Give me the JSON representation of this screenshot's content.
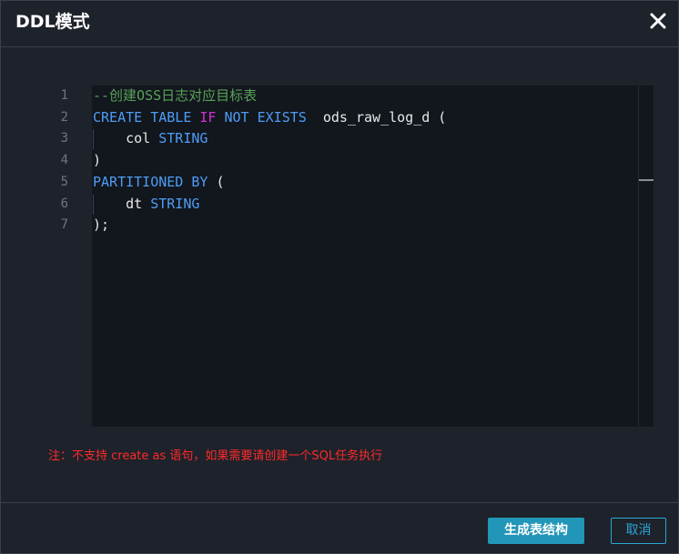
{
  "dialog": {
    "title": "DDL模式",
    "close_icon": "close-icon"
  },
  "editor": {
    "line_numbers": [
      "1",
      "2",
      "3",
      "4",
      "5",
      "6",
      "7"
    ],
    "lines": [
      {
        "tokens": [
          {
            "type": "comment",
            "text": "--创建OSS日志对应目标表"
          }
        ]
      },
      {
        "tokens": [
          {
            "type": "keyword",
            "text": "CREATE TABLE "
          },
          {
            "type": "keyword2",
            "text": "IF"
          },
          {
            "type": "keyword",
            "text": " NOT EXISTS"
          },
          {
            "type": "plain",
            "text": "  ods_raw_log_d ("
          }
        ]
      },
      {
        "tokens": [
          {
            "type": "plain",
            "text": "    col "
          },
          {
            "type": "keyword",
            "text": "STRING"
          }
        ]
      },
      {
        "tokens": [
          {
            "type": "plain",
            "text": ")"
          }
        ]
      },
      {
        "tokens": [
          {
            "type": "keyword",
            "text": "PARTITIONED BY"
          },
          {
            "type": "plain",
            "text": " ("
          }
        ]
      },
      {
        "tokens": [
          {
            "type": "plain",
            "text": "    dt "
          },
          {
            "type": "keyword",
            "text": "STRING"
          }
        ]
      },
      {
        "tokens": [
          {
            "type": "plain",
            "text": ");"
          }
        ]
      }
    ],
    "colors": {
      "keyword": "#4d9df5",
      "keyword2": "#d52fd7",
      "comment": "#58a358",
      "plain": "#e8e8e8",
      "background": "#12161d"
    }
  },
  "note": "注：不支持 create as 语句，如果需要请创建一个SQL任务执行",
  "footer": {
    "generate_label": "生成表结构",
    "cancel_label": "取消"
  }
}
